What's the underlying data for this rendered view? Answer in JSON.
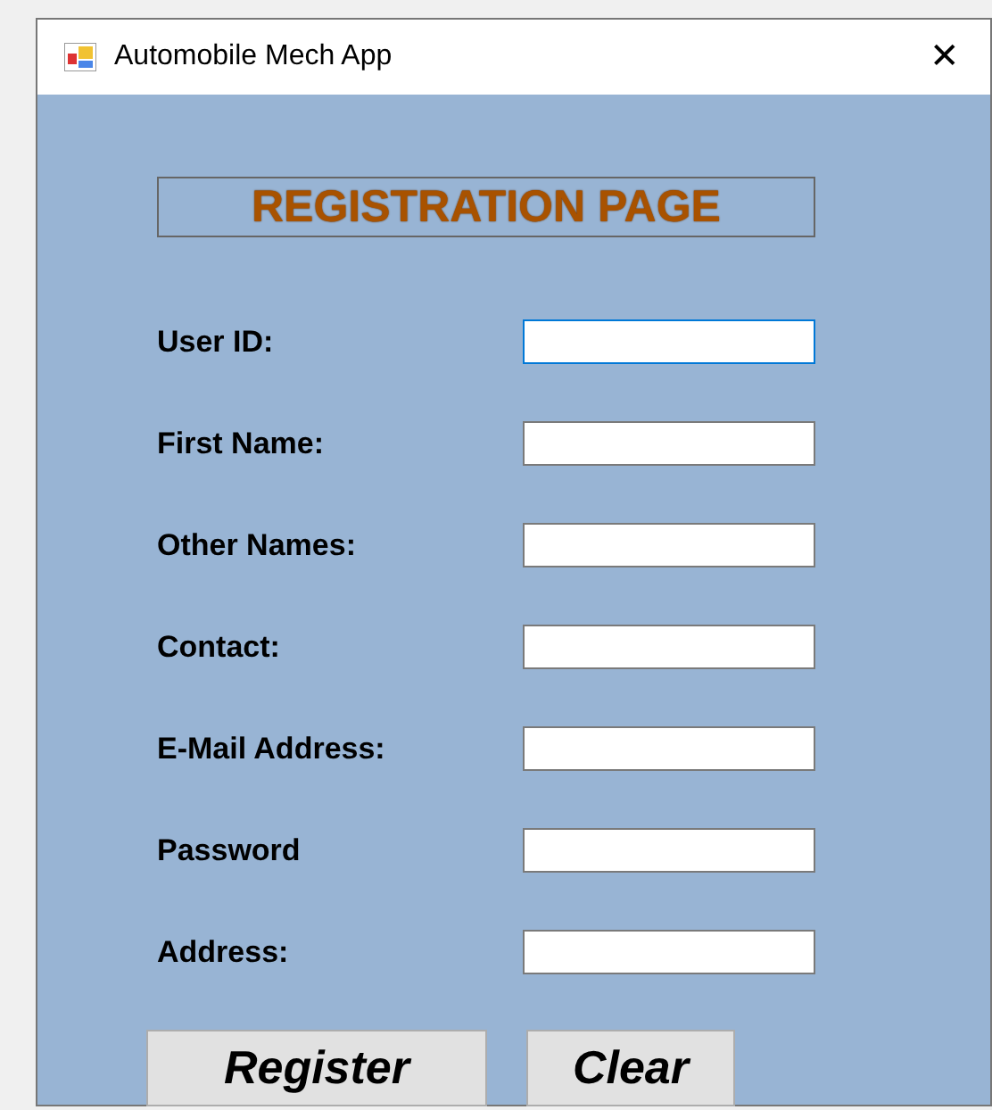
{
  "window": {
    "title": "Automobile Mech App",
    "close": "✕"
  },
  "heading": "REGISTRATION PAGE",
  "fields": [
    {
      "label": "User ID:",
      "focused": true
    },
    {
      "label": "First Name:",
      "focused": false
    },
    {
      "label": "Other Names:",
      "focused": false
    },
    {
      "label": "Contact:",
      "focused": false
    },
    {
      "label": "E-Mail Address:",
      "focused": false
    },
    {
      "label": "Password",
      "focused": false
    },
    {
      "label": "Address:",
      "focused": false
    }
  ],
  "buttons": [
    "Register",
    "Clear"
  ]
}
